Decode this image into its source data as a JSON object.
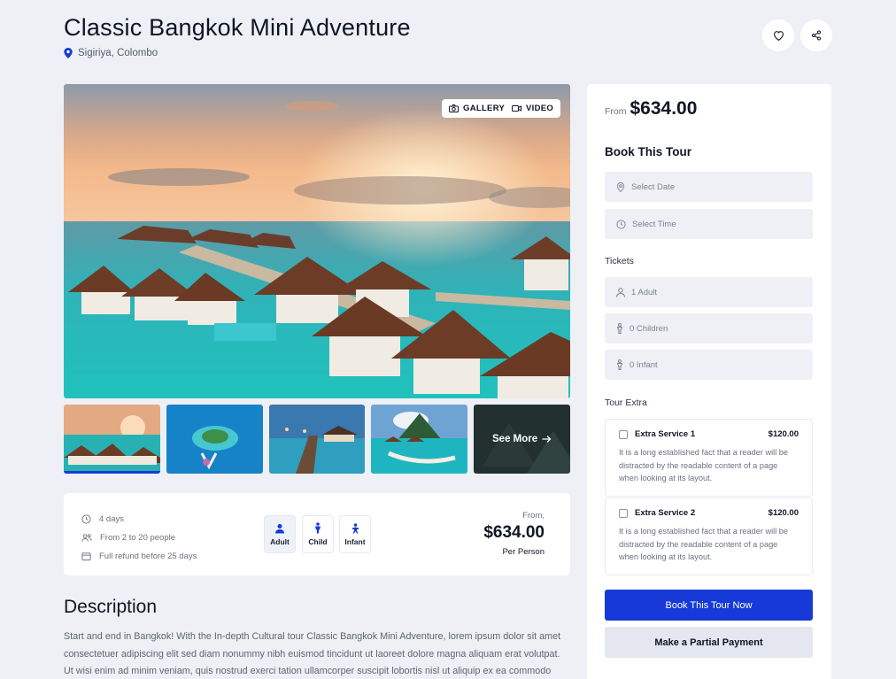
{
  "header": {
    "title": "Classic Bangkok Mini Adventure",
    "location": "Sigiriya, Colombo"
  },
  "media": {
    "gallery_label": "GALLERY",
    "video_label": "VIDEO",
    "see_more_label": "See More"
  },
  "overview": {
    "duration": "4 days",
    "group_size": "From 2 to 20 people",
    "refund": "Full refund before 25 days",
    "passengers": [
      {
        "label": "Adult"
      },
      {
        "label": "Child"
      },
      {
        "label": "Infant"
      }
    ],
    "price_prefix": "From,",
    "price": "$634.00",
    "price_suffix": "Per Person"
  },
  "description": {
    "heading": "Description",
    "text": "Start and end in Bangkok! With the In-depth Cultural tour Classic Bangkok Mini Adventure, lorem ipsum dolor sit amet consectetuer adipiscing elit sed diam nonummy nibh euismod tincidunt ut laoreet dolore magna aliquam erat volutpat. Ut wisi enim ad minim veniam, quis nostrud exerci tation ullamcorper suscipit lobortis nisl ut aliquip ex ea commodo"
  },
  "booking": {
    "from_label": "From",
    "price": "$634.00",
    "heading": "Book This Tour",
    "date_placeholder": "Select Date",
    "time_placeholder": "Select Time",
    "tickets_label": "Tickets",
    "adults": "1 Adult",
    "children": "0 Children",
    "infants": "0 Infant",
    "extra_label": "Tour Extra",
    "extras": [
      {
        "name": "Extra Service 1",
        "price": "$120.00",
        "desc": "It is a long established fact that a reader will be distracted by the readable content of a page when looking at its layout."
      },
      {
        "name": "Extra Service 2",
        "price": "$120.00",
        "desc": "It is a long established fact that a reader will be distracted by the readable content of a page when looking at its layout."
      }
    ],
    "book_button": "Book This Tour Now",
    "partial_button": "Make a Partial Payment"
  },
  "colors": {
    "accent": "#1739d8",
    "background": "#eef0f5",
    "card": "#ffffff"
  }
}
